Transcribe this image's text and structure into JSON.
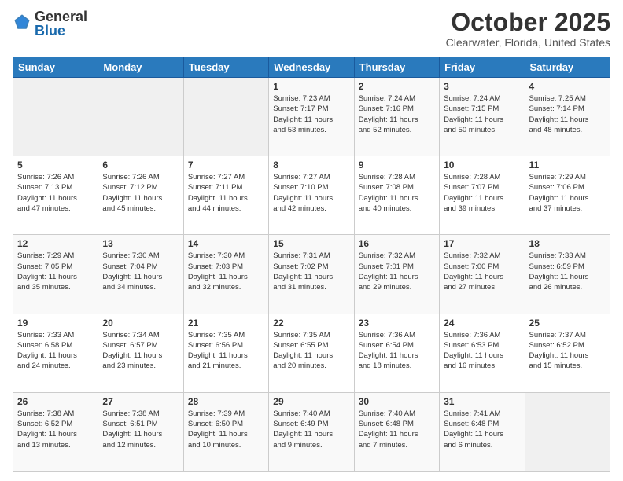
{
  "header": {
    "logo_general": "General",
    "logo_blue": "Blue",
    "title": "October 2025",
    "subtitle": "Clearwater, Florida, United States"
  },
  "weekdays": [
    "Sunday",
    "Monday",
    "Tuesday",
    "Wednesday",
    "Thursday",
    "Friday",
    "Saturday"
  ],
  "weeks": [
    [
      {
        "day": "",
        "info": ""
      },
      {
        "day": "",
        "info": ""
      },
      {
        "day": "",
        "info": ""
      },
      {
        "day": "1",
        "info": "Sunrise: 7:23 AM\nSunset: 7:17 PM\nDaylight: 11 hours\nand 53 minutes."
      },
      {
        "day": "2",
        "info": "Sunrise: 7:24 AM\nSunset: 7:16 PM\nDaylight: 11 hours\nand 52 minutes."
      },
      {
        "day": "3",
        "info": "Sunrise: 7:24 AM\nSunset: 7:15 PM\nDaylight: 11 hours\nand 50 minutes."
      },
      {
        "day": "4",
        "info": "Sunrise: 7:25 AM\nSunset: 7:14 PM\nDaylight: 11 hours\nand 48 minutes."
      }
    ],
    [
      {
        "day": "5",
        "info": "Sunrise: 7:26 AM\nSunset: 7:13 PM\nDaylight: 11 hours\nand 47 minutes."
      },
      {
        "day": "6",
        "info": "Sunrise: 7:26 AM\nSunset: 7:12 PM\nDaylight: 11 hours\nand 45 minutes."
      },
      {
        "day": "7",
        "info": "Sunrise: 7:27 AM\nSunset: 7:11 PM\nDaylight: 11 hours\nand 44 minutes."
      },
      {
        "day": "8",
        "info": "Sunrise: 7:27 AM\nSunset: 7:10 PM\nDaylight: 11 hours\nand 42 minutes."
      },
      {
        "day": "9",
        "info": "Sunrise: 7:28 AM\nSunset: 7:08 PM\nDaylight: 11 hours\nand 40 minutes."
      },
      {
        "day": "10",
        "info": "Sunrise: 7:28 AM\nSunset: 7:07 PM\nDaylight: 11 hours\nand 39 minutes."
      },
      {
        "day": "11",
        "info": "Sunrise: 7:29 AM\nSunset: 7:06 PM\nDaylight: 11 hours\nand 37 minutes."
      }
    ],
    [
      {
        "day": "12",
        "info": "Sunrise: 7:29 AM\nSunset: 7:05 PM\nDaylight: 11 hours\nand 35 minutes."
      },
      {
        "day": "13",
        "info": "Sunrise: 7:30 AM\nSunset: 7:04 PM\nDaylight: 11 hours\nand 34 minutes."
      },
      {
        "day": "14",
        "info": "Sunrise: 7:30 AM\nSunset: 7:03 PM\nDaylight: 11 hours\nand 32 minutes."
      },
      {
        "day": "15",
        "info": "Sunrise: 7:31 AM\nSunset: 7:02 PM\nDaylight: 11 hours\nand 31 minutes."
      },
      {
        "day": "16",
        "info": "Sunrise: 7:32 AM\nSunset: 7:01 PM\nDaylight: 11 hours\nand 29 minutes."
      },
      {
        "day": "17",
        "info": "Sunrise: 7:32 AM\nSunset: 7:00 PM\nDaylight: 11 hours\nand 27 minutes."
      },
      {
        "day": "18",
        "info": "Sunrise: 7:33 AM\nSunset: 6:59 PM\nDaylight: 11 hours\nand 26 minutes."
      }
    ],
    [
      {
        "day": "19",
        "info": "Sunrise: 7:33 AM\nSunset: 6:58 PM\nDaylight: 11 hours\nand 24 minutes."
      },
      {
        "day": "20",
        "info": "Sunrise: 7:34 AM\nSunset: 6:57 PM\nDaylight: 11 hours\nand 23 minutes."
      },
      {
        "day": "21",
        "info": "Sunrise: 7:35 AM\nSunset: 6:56 PM\nDaylight: 11 hours\nand 21 minutes."
      },
      {
        "day": "22",
        "info": "Sunrise: 7:35 AM\nSunset: 6:55 PM\nDaylight: 11 hours\nand 20 minutes."
      },
      {
        "day": "23",
        "info": "Sunrise: 7:36 AM\nSunset: 6:54 PM\nDaylight: 11 hours\nand 18 minutes."
      },
      {
        "day": "24",
        "info": "Sunrise: 7:36 AM\nSunset: 6:53 PM\nDaylight: 11 hours\nand 16 minutes."
      },
      {
        "day": "25",
        "info": "Sunrise: 7:37 AM\nSunset: 6:52 PM\nDaylight: 11 hours\nand 15 minutes."
      }
    ],
    [
      {
        "day": "26",
        "info": "Sunrise: 7:38 AM\nSunset: 6:52 PM\nDaylight: 11 hours\nand 13 minutes."
      },
      {
        "day": "27",
        "info": "Sunrise: 7:38 AM\nSunset: 6:51 PM\nDaylight: 11 hours\nand 12 minutes."
      },
      {
        "day": "28",
        "info": "Sunrise: 7:39 AM\nSunset: 6:50 PM\nDaylight: 11 hours\nand 10 minutes."
      },
      {
        "day": "29",
        "info": "Sunrise: 7:40 AM\nSunset: 6:49 PM\nDaylight: 11 hours\nand 9 minutes."
      },
      {
        "day": "30",
        "info": "Sunrise: 7:40 AM\nSunset: 6:48 PM\nDaylight: 11 hours\nand 7 minutes."
      },
      {
        "day": "31",
        "info": "Sunrise: 7:41 AM\nSunset: 6:48 PM\nDaylight: 11 hours\nand 6 minutes."
      },
      {
        "day": "",
        "info": ""
      }
    ]
  ]
}
